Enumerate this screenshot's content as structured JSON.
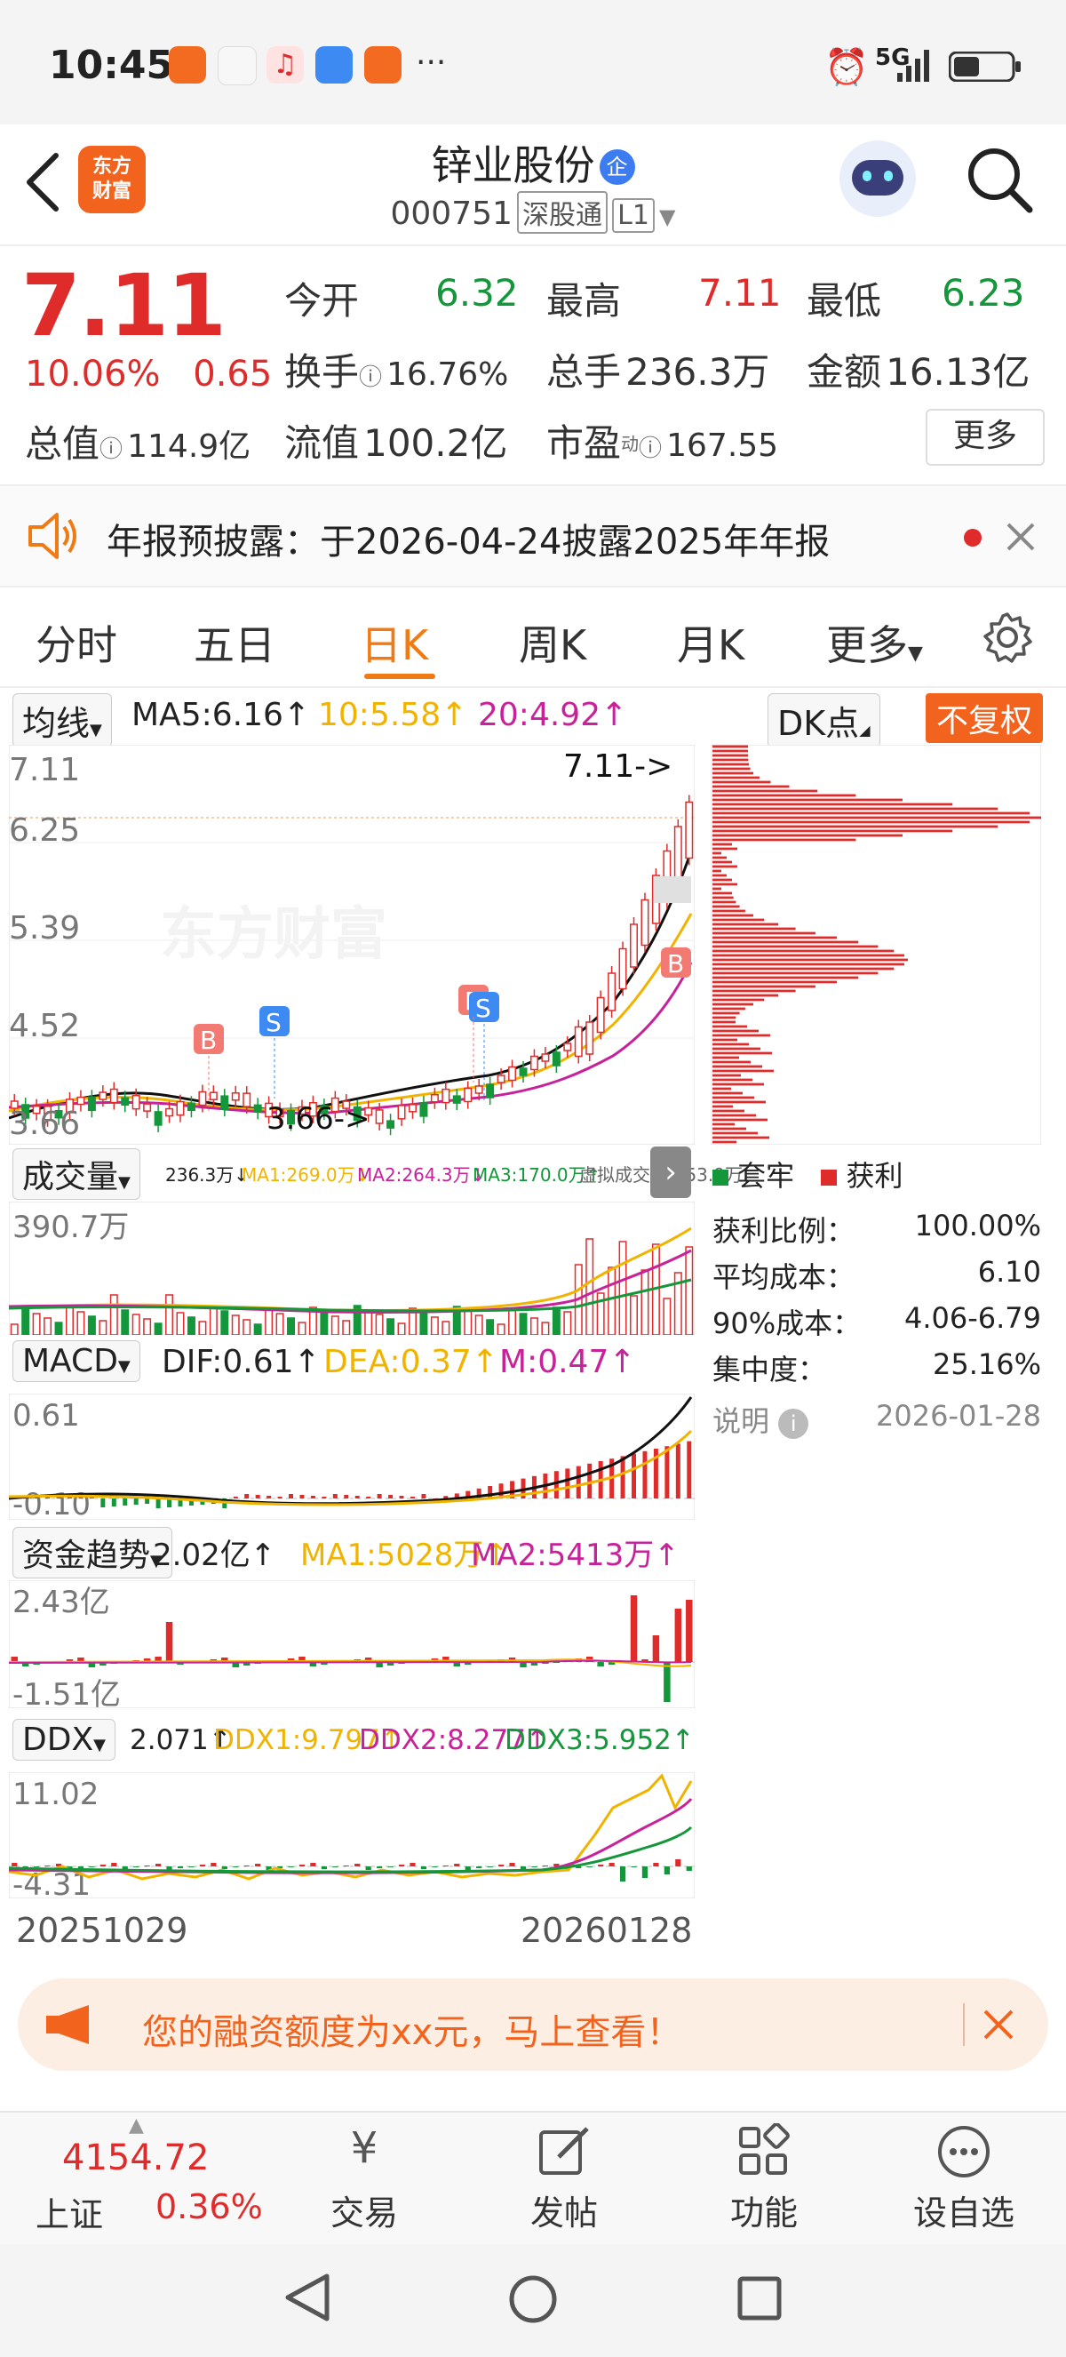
{
  "status": {
    "time": "10:45",
    "network": "5G"
  },
  "header": {
    "stock_name": "锌业股份",
    "badge": "企",
    "code": "000751",
    "tag1": "深股通",
    "tag2": "L1",
    "logo_line1": "东方",
    "logo_line2": "财富"
  },
  "quote": {
    "price": "7.11",
    "change_pct": "10.06%",
    "change": "0.65",
    "open_label": "今开",
    "open": "6.32",
    "high_label": "最高",
    "high": "7.11",
    "low_label": "最低",
    "low": "6.23",
    "turnover_label": "换手",
    "turnover": "16.76%",
    "volume_label": "总手",
    "volume": "236.3万",
    "amount_label": "金额",
    "amount": "16.13亿",
    "total_cap_label": "总值",
    "total_cap": "114.9亿",
    "float_cap_label": "流值",
    "float_cap": "100.2亿",
    "pe_label": "市盈",
    "pe_sup": "动",
    "pe": "167.55",
    "more_button": "更多"
  },
  "notice": {
    "text": "年报预披露：于2026-04-24披露2025年年报"
  },
  "tabs": [
    "分时",
    "五日",
    "日K",
    "周K",
    "月K",
    "更多"
  ],
  "active_tab": 2,
  "kline": {
    "ma_selector": "均线",
    "ma5": "MA5:6.16↑",
    "ma10": "10:5.58↑",
    "ma20": "20:4.92↑",
    "dk_button": "DK点",
    "fq_button": "不复权",
    "y_labels": [
      "7.11",
      "6.25",
      "5.39",
      "4.52",
      "3.66"
    ],
    "high_marker": "7.11->",
    "low_marker": "3.66->",
    "watermark": "东方财富",
    "signals": [
      "B",
      "S",
      "B",
      "S",
      "B"
    ]
  },
  "volume": {
    "selector": "成交量",
    "v": "236.3万↓",
    "ma1": "MA1:269.0万↓",
    "ma2": "MA2:264.3万↓",
    "ma3": "MA3:170.0万↑",
    "virtual": "虚拟成交量:353.9万",
    "y_max": "390.7万"
  },
  "macd": {
    "selector": "MACD",
    "dif": "DIF:0.61↑",
    "dea": "DEA:0.37↑",
    "m": "M:0.47↑",
    "y_max": "0.61",
    "y_min": "-0.10"
  },
  "fund": {
    "selector": "资金趋势",
    "v": "2.02亿↑",
    "ma1": "MA1:5028万↑",
    "ma2": "MA2:5413万↑",
    "y_max": "2.43亿",
    "y_min": "-1.51亿"
  },
  "ddx": {
    "selector": "DDX",
    "v": "2.071↑",
    "ddx1": "DDX1:9.797↑",
    "ddx2": "DDX2:8.277↑",
    "ddx3": "DDX3:5.952↑",
    "y_max": "11.02",
    "y_min": "-4.31"
  },
  "dates": {
    "start": "20251029",
    "end": "20260128"
  },
  "chip": {
    "legend_trapped": "套牢",
    "legend_profit": "获利",
    "rows": [
      {
        "label": "获利比例：",
        "value": "100.00%"
      },
      {
        "label": "平均成本：",
        "value": "6.10"
      },
      {
        "label": "90%成本：",
        "value": "4.06-6.79"
      },
      {
        "label": "集中度：",
        "value": "25.16%"
      }
    ],
    "note_label": "说明",
    "note_date": "2026-01-28"
  },
  "banner": {
    "text": "您的融资额度为xx元，马上查看！"
  },
  "bottom_nav": {
    "index_value": "4154.72",
    "index_name": "上证",
    "index_change": "0.36%",
    "items": [
      "交易",
      "发帖",
      "功能",
      "设自选"
    ]
  },
  "colors": {
    "up": "#e02b2b",
    "down": "#14963a",
    "accent": "#f07a14",
    "ma10": "#f0b400",
    "ma20": "#c8229a"
  }
}
